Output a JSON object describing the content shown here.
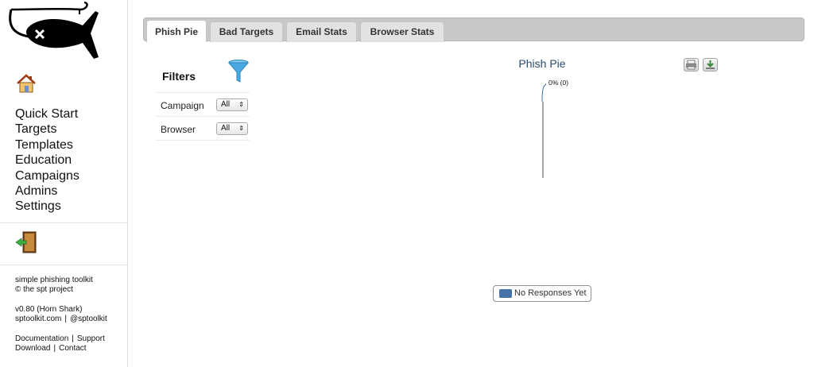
{
  "sidebar": {
    "logo_icon": "shark-fish-logo-icon",
    "home_icon": "home-icon",
    "nav": [
      "Quick Start",
      "Targets",
      "Templates",
      "Education",
      "Campaigns",
      "Admins",
      "Settings"
    ],
    "logout_icon": "door-exit-icon",
    "about": {
      "product": "simple phishing toolkit",
      "copyright": "© the spt project",
      "version": "v0.80 (Horn Shark)",
      "website": "sptoolkit.com",
      "twitter": "@sptoolkit",
      "documentation": "Documentation",
      "support": "Support",
      "download": "Download",
      "contact": "Contact"
    }
  },
  "tabs": [
    "Phish Pie",
    "Bad Targets",
    "Email Stats",
    "Browser Stats"
  ],
  "active_tab": "Phish Pie",
  "filters": {
    "title": "Filters",
    "icon": "funnel-icon",
    "rows": [
      {
        "label": "Campaign",
        "value": "All"
      },
      {
        "label": "Browser",
        "value": "All"
      }
    ]
  },
  "chart": {
    "print_icon": "print-icon",
    "download_icon": "download-icon"
  },
  "chart_data": {
    "type": "pie",
    "title": "Phish Pie",
    "slices": [
      {
        "label": "No Responses Yet",
        "value": 0,
        "percent": 0,
        "color": "#4572a7"
      }
    ],
    "data_labels": [
      "0% (0)"
    ],
    "legend": [
      "No Responses Yet"
    ],
    "legend_position": "bottom"
  }
}
